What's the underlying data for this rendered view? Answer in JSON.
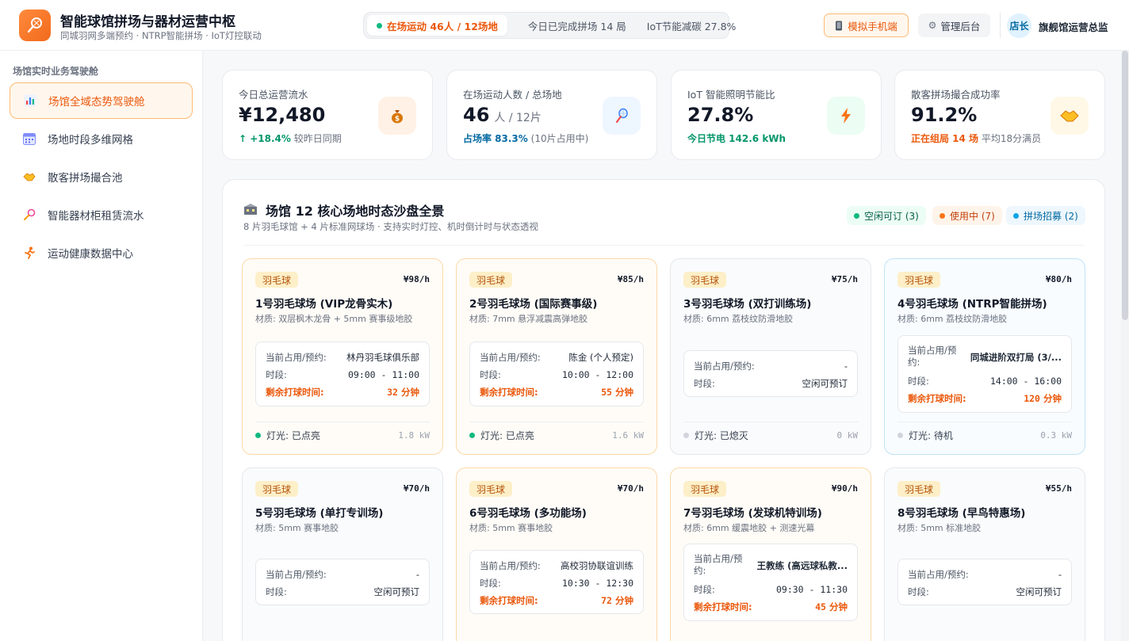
{
  "header": {
    "title": "智能球馆拼场与器材运营中枢",
    "subtitle": "同城羽网多端预约 · NTRP智能拼场 · IoT灯控联动",
    "status_active": "在场运动 46人 / 12场地",
    "status_done": "今日已完成拼场 14 局",
    "status_iot": "IoT节能减碳 27.8%",
    "sim_button": "模拟手机端",
    "admin_button": "管理后台",
    "avatar_text": "店长",
    "user_name": "旗舰馆运营总监"
  },
  "sidebar": {
    "heading": "场馆实时业务驾驶舱",
    "items": [
      {
        "label": "场馆全域态势驾驶舱",
        "icon": "bar-chart-icon",
        "active": true
      },
      {
        "label": "场地时段多维网格",
        "icon": "calendar-icon",
        "active": false
      },
      {
        "label": "散客拼场撮合池",
        "icon": "handshake-icon",
        "active": false
      },
      {
        "label": "智能器材柜租赁流水",
        "icon": "racket-icon",
        "active": false
      },
      {
        "label": "运动健康数据中心",
        "icon": "runner-icon",
        "active": false
      }
    ]
  },
  "stats": [
    {
      "label": "今日总运营流水",
      "value": "¥12,480",
      "unit": "",
      "sub_highlight": "↑ +18.4%",
      "sub_text": "较昨日同期",
      "highlight_color": "#059669",
      "icon": "money-bag-icon",
      "icon_bg": "#fff1e6"
    },
    {
      "label": "在场运动人数 / 总场地",
      "value": "46",
      "unit": "人 / 12片",
      "sub_highlight": "占场率 83.3%",
      "sub_text": "(10片占用中)",
      "highlight_color": "#0369a1",
      "icon": "racket-icon",
      "icon_bg": "#eef6ff"
    },
    {
      "label": "IoT 智能照明节能比",
      "value": "27.8%",
      "unit": "",
      "sub_highlight": "今日节电 142.6 kWh",
      "sub_text": "",
      "highlight_color": "#059669",
      "icon": "lightning-icon",
      "icon_bg": "#ecfdf3"
    },
    {
      "label": "散客拼场撮合成功率",
      "value": "91.2%",
      "unit": "",
      "sub_highlight": "正在组局 14 场",
      "sub_text": "平均18分满员",
      "highlight_color": "#ea580c",
      "icon": "handshake-icon",
      "icon_bg": "#fff8e6"
    }
  ],
  "panel": {
    "title": "场馆 12 核心场地时态沙盘全景",
    "subtitle": "8 片羽毛球馆 + 4 片标准网球场 · 支持实时灯控、机时倒计时与状态透视",
    "legend": [
      {
        "label": "空闲可订 (3)",
        "color": "#10b981",
        "bg": "#ecfdf5",
        "text": "#065f46"
      },
      {
        "label": "使用中 (7)",
        "color": "#f97316",
        "bg": "#fff4ea",
        "text": "#c2410c"
      },
      {
        "label": "拼场招募 (2)",
        "color": "#0ea5e9",
        "bg": "#eef7fd",
        "text": "#0369a1"
      }
    ]
  },
  "labels": {
    "occupant": "当前占用/预约:",
    "slot": "时段:",
    "remain": "剩余打球时间:",
    "minute_unit": "分钟"
  },
  "courts": [
    {
      "tag": "羽毛球",
      "price": "¥98/h",
      "name": "1号羽毛球场 (VIP龙骨实木)",
      "material": "材质: 双层枫木龙骨 + 5mm 赛事级地胶",
      "state": "busy",
      "occupant": "林丹羽毛球俱乐部",
      "slot": "09:00 - 11:00",
      "remain": "32",
      "light": "灯光: 已点亮",
      "light_color": "#10b981",
      "power": "1.8 kW"
    },
    {
      "tag": "羽毛球",
      "price": "¥85/h",
      "name": "2号羽毛球场 (国际赛事级)",
      "material": "材质: 7mm 悬浮减震高弹地胶",
      "state": "busy",
      "occupant": "陈金 (个人预定)",
      "slot": "10:00 - 12:00",
      "remain": "55",
      "light": "灯光: 已点亮",
      "light_color": "#10b981",
      "power": "1.6 kW"
    },
    {
      "tag": "羽毛球",
      "price": "¥75/h",
      "name": "3号羽毛球场 (双打训练场)",
      "material": "材质: 6mm 荔枝纹防滑地胶",
      "state": "idle",
      "occupant": "-",
      "slot": "空闲可预订",
      "remain": "",
      "light": "灯光: 已熄灭",
      "light_color": "#d1d5db",
      "power": "0 kW"
    },
    {
      "tag": "羽毛球",
      "price": "¥80/h",
      "name": "4号羽毛球场 (NTRP智能拼场)",
      "material": "材质: 6mm 荔枝纹防滑地胶",
      "state": "recruit",
      "occupant": "同城进阶双打局 (3/...",
      "slot": "14:00 - 16:00",
      "remain": "120",
      "light": "灯光: 待机",
      "light_color": "#d1d5db",
      "power": "0.3 kW"
    },
    {
      "tag": "羽毛球",
      "price": "¥70/h",
      "name": "5号羽毛球场 (单打专训场)",
      "material": "材质: 5mm 赛事地胶",
      "state": "idle",
      "occupant": "-",
      "slot": "空闲可预订",
      "remain": "",
      "light": "",
      "light_color": "#d1d5db",
      "power": ""
    },
    {
      "tag": "羽毛球",
      "price": "¥70/h",
      "name": "6号羽毛球场 (多功能场)",
      "material": "材质: 5mm 赛事地胶",
      "state": "busy",
      "occupant": "高校羽协联谊训练",
      "slot": "10:30 - 12:30",
      "remain": "72",
      "light": "",
      "light_color": "#10b981",
      "power": ""
    },
    {
      "tag": "羽毛球",
      "price": "¥90/h",
      "name": "7号羽毛球场 (发球机特训场)",
      "material": "材质: 6mm 缓震地胶 + 测速光幕",
      "state": "busy",
      "occupant": "王教练 (高远球私教...",
      "slot": "09:30 - 11:30",
      "remain": "45",
      "light": "",
      "light_color": "#10b981",
      "power": ""
    },
    {
      "tag": "羽毛球",
      "price": "¥55/h",
      "name": "8号羽毛球场 (早鸟特惠场)",
      "material": "材质: 5mm 标准地胶",
      "state": "idle",
      "occupant": "-",
      "slot": "空闲可预订",
      "remain": "",
      "light": "",
      "light_color": "#d1d5db",
      "power": ""
    }
  ]
}
